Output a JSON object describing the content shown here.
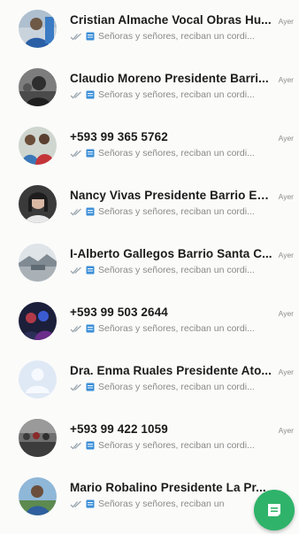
{
  "chats": [
    {
      "name": "Cristian Almache Vocal Obras Hu...",
      "time": "Ayer",
      "preview": "Señoras y señores, reciban un cordi...",
      "avatar": "photo-man-blue"
    },
    {
      "name": "Claudio Moreno Presidente Barri...",
      "time": "Ayer",
      "preview": "Señoras y señores, reciban un cordi...",
      "avatar": "photo-man-dark"
    },
    {
      "name": "+593 99 365 5762",
      "time": "Ayer",
      "preview": "Señoras y señores, reciban un cordi...",
      "avatar": "photo-two-people"
    },
    {
      "name": "Nancy Vivas Presidente Barrio Es...",
      "time": "Ayer",
      "preview": "Señoras y señores, reciban un cordi...",
      "avatar": "photo-woman"
    },
    {
      "name": "I-Alberto Gallegos Barrio Santa C...",
      "time": "Ayer",
      "preview": "Señoras y señores, reciban un cordi...",
      "avatar": "photo-landscape"
    },
    {
      "name": "+593 99 503 2644",
      "time": "Ayer",
      "preview": "Señoras y señores, reciban un cordi...",
      "avatar": "photo-group-dark"
    },
    {
      "name": "Dra. Enma Ruales Presidente Ato...",
      "time": "Ayer",
      "preview": "Señoras y señores, reciban un cordi...",
      "avatar": "default-person-icon"
    },
    {
      "name": "+593 99 422 1059",
      "time": "Ayer",
      "preview": "Señoras y señores, reciban un cordi...",
      "avatar": "photo-crowd"
    },
    {
      "name": "Mario Robalino Presidente La Pr...",
      "time": "",
      "preview": "Señoras y señores, reciban un",
      "avatar": "photo-man-outdoor"
    }
  ],
  "fab": {
    "icon": "new-chat-icon",
    "color": "#2fb36a"
  },
  "colors": {
    "name": "#1b1b1b",
    "meta": "#8a8a8a",
    "ticks": "#9aa7b0",
    "doc": "#3b8fd8"
  }
}
